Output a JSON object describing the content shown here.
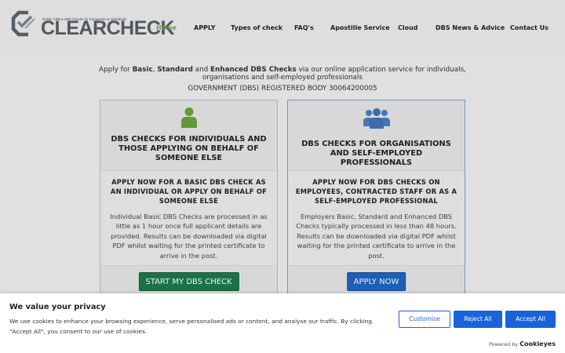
{
  "header": {
    "logo_text": "CLEARCHECK",
    "logo_tagline": "Online CRB & DBS Checks for Companies & Individuals",
    "nav": [
      {
        "label": "Home",
        "active": true
      },
      {
        "label": "APPLY",
        "active": false
      },
      {
        "label": "Types of check",
        "active": false
      },
      {
        "label": "FAQ's",
        "active": false
      },
      {
        "label": "Apostille Service",
        "active": false
      },
      {
        "label": "Cloud",
        "active": false
      },
      {
        "label": "DBS News & Advice",
        "active": false
      },
      {
        "label": "Contact Us",
        "active": false
      }
    ]
  },
  "intro": {
    "prefix": "Apply for ",
    "basic": "Basic",
    "sep1": ", ",
    "standard": "Standard",
    "sep2": " and ",
    "enhanced": "Enhanced DBS Checks",
    "suffix": " via our online application service for individuals, organisations and self-employed professionals",
    "registered": "GOVERNMENT (DBS) REGISTERED BODY 30064200005"
  },
  "cards": [
    {
      "icon": "user-icon",
      "title": "DBS CHECKS FOR INDIVIDUALS AND THOSE APPLYING ON BEHALF OF SOMEONE ELSE",
      "subtitle": "APPLY NOW FOR A BASIC DBS CHECK AS AN INDIVIDUAL OR APPLY ON BEHALF OF SOMEONE ELSE",
      "body": "Individual Basic DBS Checks are processed in as little as 1 hour once full applicant details are provided. Results can be downloaded via digital PDF whilst waiting for the printed certificate to arrive in the post.",
      "button": "START MY DBS CHECK",
      "icon_color": "#6aa23a",
      "button_color": "#1e7a4c"
    },
    {
      "icon": "users-group-icon",
      "title": "DBS CHECKS FOR ORGANISATIONS AND SELF-EMPLOYED PROFESSIONALS",
      "subtitle": "APPLY NOW FOR DBS CHECKS ON EMPLOYEES, CONTRACTED STAFF OR AS A SELF-EMPLOYED PROFESSIONAL",
      "body": "Employers Basic, Standard and Enhanced DBS Checks typically processed in less than 48 hours. Results can be downloaded via digital PDF whilst waiting for the printed certificate to arrive in the post.",
      "button": "APPLY NOW",
      "icon_color": "#4a7fc1",
      "button_color": "#1f64c2"
    }
  ],
  "cookie": {
    "title": "We value your privacy",
    "text": "We use cookies to enhance your browsing experience, serve personalised ads or content, and analyse our traffic. By clicking \"Accept All\", you consent to our use of cookies.",
    "customise": "Customise",
    "reject": "Reject All",
    "accept": "Accept All",
    "powered_prefix": "Powered by",
    "powered_brand": "Cookieyes",
    "accent": "#1863dc"
  }
}
